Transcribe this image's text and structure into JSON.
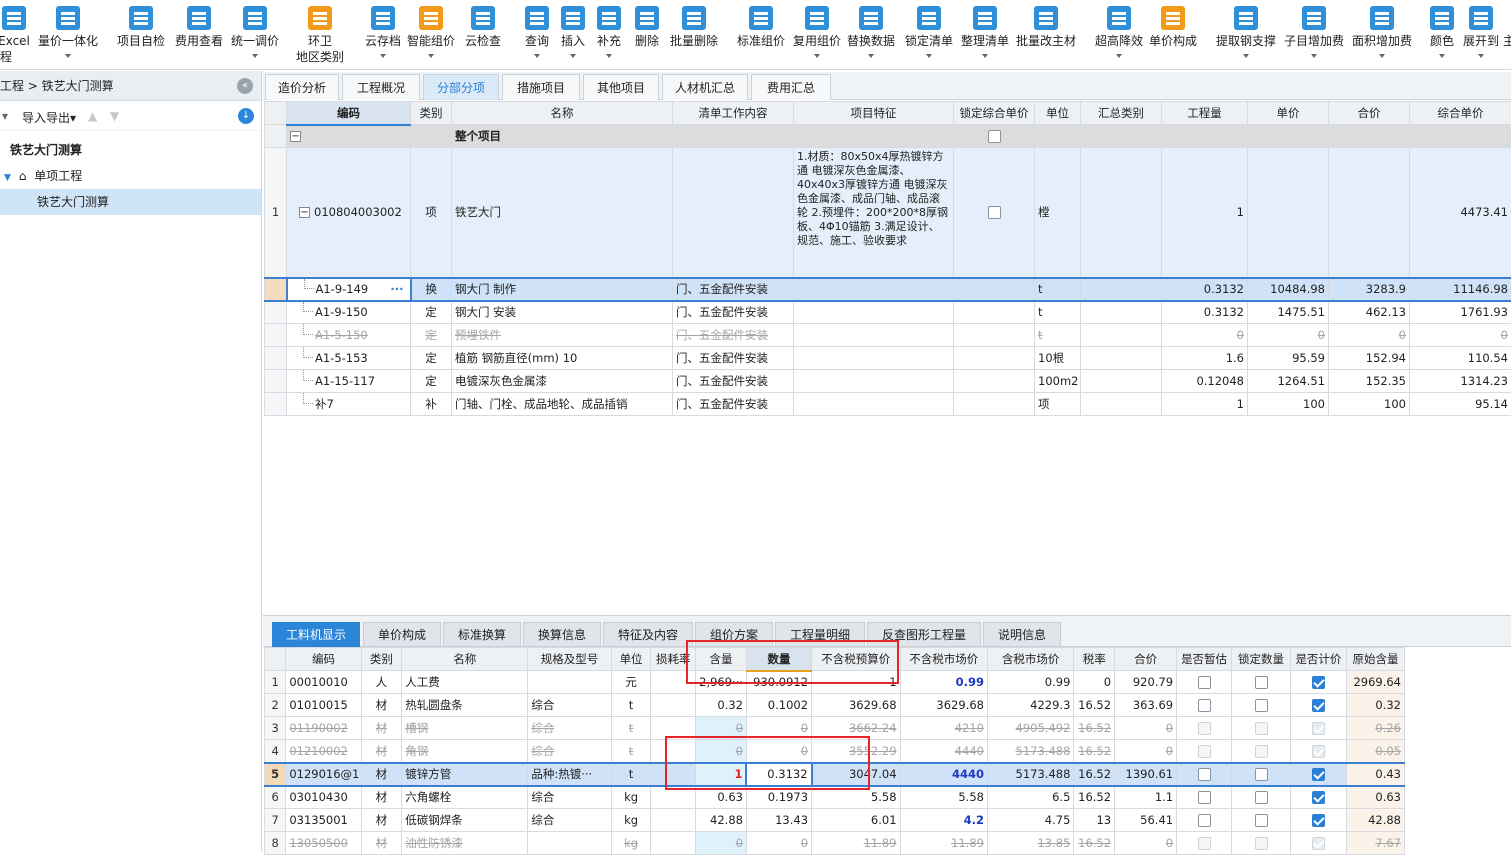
{
  "toolbar": {
    "buttons": [
      {
        "label": "Excel",
        "label2": "程",
        "icon": "excel-icon"
      },
      {
        "label": "量价一体化",
        "icon": "integrate-icon"
      },
      {
        "label": "项目自检",
        "icon": "check-icon"
      },
      {
        "label": "费用查看",
        "icon": "fee-view-icon"
      },
      {
        "label": "统一调价",
        "icon": "adjust-price-icon"
      },
      {
        "label": "环卫",
        "label2": "地区类别",
        "icon": "region-icon"
      },
      {
        "label": "云存档",
        "icon": "cloud-save-icon"
      },
      {
        "label": "智能组价",
        "icon": "smart-price-icon"
      },
      {
        "label": "云检查",
        "icon": "cloud-check-icon"
      },
      {
        "label": "查询",
        "icon": "query-icon"
      },
      {
        "label": "插入",
        "icon": "insert-icon"
      },
      {
        "label": "补充",
        "icon": "supplement-icon"
      },
      {
        "label": "删除",
        "icon": "delete-icon"
      },
      {
        "label": "批量删除",
        "icon": "batch-delete-icon"
      },
      {
        "label": "标准组价",
        "icon": "standard-price-icon"
      },
      {
        "label": "复用组价",
        "icon": "reuse-price-icon"
      },
      {
        "label": "替换数据",
        "icon": "replace-data-icon"
      },
      {
        "label": "锁定清单",
        "icon": "lock-list-icon"
      },
      {
        "label": "整理清单",
        "icon": "organize-list-icon"
      },
      {
        "label": "批量改主材",
        "icon": "batch-material-icon"
      },
      {
        "label": "超高降效",
        "icon": "height-efficiency-icon"
      },
      {
        "label": "单价构成",
        "icon": "unit-price-icon"
      },
      {
        "label": "提取钢支撑",
        "icon": "steel-support-icon"
      },
      {
        "label": "子目增加费",
        "icon": "sub-item-fee-icon"
      },
      {
        "label": "面积增加费",
        "icon": "area-fee-icon"
      },
      {
        "label": "颜色",
        "icon": "color-icon"
      },
      {
        "label": "展开到",
        "icon": "expand-icon"
      },
      {
        "label": "主",
        "icon": "more-icon"
      }
    ]
  },
  "left": {
    "breadcrumb": "工程 > 铁艺大门测算",
    "import_export": "导入导出",
    "tree": [
      "铁艺大门测算",
      "单项工程",
      "铁艺大门测算"
    ]
  },
  "main_tabs": [
    "造价分析",
    "工程概况",
    "分部分项",
    "措施项目",
    "其他项目",
    "人材机汇总",
    "费用汇总"
  ],
  "top_grid": {
    "headers": [
      "编码",
      "类别",
      "名称",
      "清单工作内容",
      "项目特征",
      "锁定综合单价",
      "单位",
      "汇总类别",
      "工程量",
      "单价",
      "合价",
      "综合单价"
    ],
    "summary_label": "整个项目",
    "item": {
      "no": "1",
      "code": "010804003002",
      "type": "项",
      "name": "铁艺大门",
      "features": "1.材质：80x50x4厚热镀锌方通 电镀深灰色金属漆、40x40x3厚镀锌方通 电镀深灰色金属漆、成品门轴、成品滚轮\n2.预埋件：200*200*8厚钢板、4Φ10锚筋\n3.满足设计、规范、施工、验收要求",
      "unit": "樘",
      "qty": "1",
      "comp_price": "4473.41"
    },
    "rows": [
      {
        "code": "A1-9-149",
        "type": "换",
        "name": "钢大门 制作",
        "work": "门、五金配件安装",
        "unit": "t",
        "qty": "0.3132",
        "price": "10484.98",
        "total": "3283.9",
        "comp": "11146.98"
      },
      {
        "code": "A1-9-150",
        "type": "定",
        "name": "钢大门 安装",
        "work": "门、五金配件安装",
        "unit": "t",
        "qty": "0.3132",
        "price": "1475.51",
        "total": "462.13",
        "comp": "1761.93"
      },
      {
        "code": "A1-5-150",
        "type": "定",
        "name": "预埋铁件",
        "work": "门、五金配件安装",
        "unit": "t",
        "qty": "0",
        "price": "0",
        "total": "0",
        "comp": "0"
      },
      {
        "code": "A1-5-153",
        "type": "定",
        "name": "植筋 钢筋直径(mm) 10",
        "work": "门、五金配件安装",
        "unit": "10根",
        "qty": "1.6",
        "price": "95.59",
        "total": "152.94",
        "comp": "110.54"
      },
      {
        "code": "A1-15-117",
        "type": "定",
        "name": "电镀深灰色金属漆",
        "work": "门、五金配件安装",
        "unit": "100m2",
        "qty": "0.12048",
        "price": "1264.51",
        "total": "152.35",
        "comp": "1314.23"
      },
      {
        "code": "补7",
        "type": "补",
        "name": "门轴、门栓、成品地轮、成品插销",
        "work": "门、五金配件安装",
        "unit": "项",
        "qty": "1",
        "price": "100",
        "total": "100",
        "comp": "95.14"
      }
    ],
    "ellipsis": "···"
  },
  "bottom_tabs": [
    "工料机显示",
    "单价构成",
    "标准换算",
    "换算信息",
    "特征及内容",
    "组价方案",
    "工程量明细",
    "反查图形工程量",
    "说明信息"
  ],
  "bottom_grid": {
    "headers": [
      "编码",
      "类别",
      "名称",
      "规格及型号",
      "单位",
      "损耗率",
      "含量",
      "数量",
      "不含税预算价",
      "不含税市场价",
      "含税市场价",
      "税率",
      "合价",
      "是否暂估",
      "锁定数量",
      "是否计价",
      "原始含量"
    ],
    "rows": [
      {
        "no": "1",
        "code": "00010010",
        "type": "人",
        "name": "人工费",
        "spec": "",
        "unit": "元",
        "loss": "",
        "content": "2,969···",
        "amount": "930.0912",
        "budget": "1",
        "market": "0.99",
        "market_tax": "0.99",
        "tax": "0",
        "total": "920.79",
        "est": false,
        "lock": false,
        "priced": true,
        "orig": "2969.64"
      },
      {
        "no": "2",
        "code": "01010015",
        "type": "材",
        "name": "热轧圆盘条",
        "spec": "综合",
        "unit": "t",
        "loss": "",
        "content": "0.32",
        "amount": "0.1002",
        "budget": "3629.68",
        "market": "3629.68",
        "market_tax": "4229.3",
        "tax": "16.52",
        "total": "363.69",
        "est": false,
        "lock": false,
        "priced": true,
        "orig": "0.32"
      },
      {
        "no": "3",
        "code": "01190002",
        "type": "材",
        "name": "槽钢",
        "spec": "综合",
        "unit": "t",
        "loss": "",
        "content": "0",
        "amount": "0",
        "budget": "3662.24",
        "market": "4210",
        "market_tax": "4905.492",
        "tax": "16.52",
        "total": "0",
        "est": false,
        "lock": false,
        "priced": true,
        "orig": "0.26"
      },
      {
        "no": "4",
        "code": "01210002",
        "type": "材",
        "name": "角钢",
        "spec": "综合",
        "unit": "t",
        "loss": "",
        "content": "0",
        "amount": "0",
        "budget": "3552.29",
        "market": "4440",
        "market_tax": "5173.488",
        "tax": "16.52",
        "total": "0",
        "est": false,
        "lock": false,
        "priced": true,
        "orig": "0.05"
      },
      {
        "no": "5",
        "code": "0129016@1",
        "type": "材",
        "name": "镀锌方管",
        "spec": "品种:热镀···",
        "unit": "t",
        "loss": "",
        "content": "1",
        "amount": "0.3132",
        "budget": "3047.04",
        "market": "4440",
        "market_tax": "5173.488",
        "tax": "16.52",
        "total": "1390.61",
        "est": false,
        "lock": false,
        "priced": true,
        "orig": "0.43"
      },
      {
        "no": "6",
        "code": "03010430",
        "type": "材",
        "name": "六角螺栓",
        "spec": "综合",
        "unit": "kg",
        "loss": "",
        "content": "0.63",
        "amount": "0.1973",
        "budget": "5.58",
        "market": "5.58",
        "market_tax": "6.5",
        "tax": "16.52",
        "total": "1.1",
        "est": false,
        "lock": false,
        "priced": true,
        "orig": "0.63"
      },
      {
        "no": "7",
        "code": "03135001",
        "type": "材",
        "name": "低碳钢焊条",
        "spec": "综合",
        "unit": "kg",
        "loss": "",
        "content": "42.88",
        "amount": "13.43",
        "budget": "6.01",
        "market": "4.2",
        "market_tax": "4.75",
        "tax": "13",
        "total": "56.41",
        "est": false,
        "lock": false,
        "priced": true,
        "orig": "42.88"
      },
      {
        "no": "8",
        "code": "13050500",
        "type": "材",
        "name": "油性防锈漆",
        "spec": "",
        "unit": "kg",
        "loss": "",
        "content": "0",
        "amount": "0",
        "budget": "11.89",
        "market": "11.89",
        "market_tax": "13.85",
        "tax": "16.52",
        "total": "0",
        "est": false,
        "lock": false,
        "priced": true,
        "orig": "7.67"
      }
    ]
  },
  "colors": {
    "accent": "#2b85d8",
    "highlight_red": "#e4262b",
    "selected_row": "#cfe2f7"
  }
}
